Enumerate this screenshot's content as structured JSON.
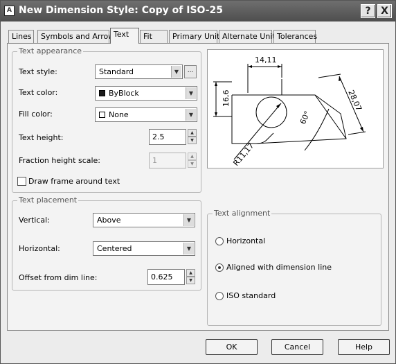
{
  "window": {
    "title": "New Dimension Style: Copy of ISO-25",
    "icon_glyph": "A",
    "help_glyph": "?",
    "close_glyph": "X"
  },
  "tabs": [
    "Lines",
    "Symbols and Arrows",
    "Text",
    "Fit",
    "Primary Units",
    "Alternate Units",
    "Tolerances"
  ],
  "active_tab": "Text",
  "text_appearance": {
    "group_label": "Text appearance",
    "text_style_label": "Text style:",
    "text_style_value": "Standard",
    "text_style_browse": "...",
    "text_color_label": "Text color:",
    "text_color_value": "ByBlock",
    "fill_color_label": "Fill color:",
    "fill_color_value": "None",
    "text_height_label": "Text height:",
    "text_height_value": "2.5",
    "fraction_height_label": "Fraction height scale:",
    "fraction_height_value": "1",
    "draw_frame_label": "Draw frame around text",
    "draw_frame_checked": false
  },
  "text_placement": {
    "group_label": "Text placement",
    "vertical_label": "Vertical:",
    "vertical_value": "Above",
    "horizontal_label": "Horizontal:",
    "horizontal_value": "Centered",
    "offset_label": "Offset from dim line:",
    "offset_value": "0.625"
  },
  "text_alignment": {
    "group_label": "Text alignment",
    "options": [
      "Horizontal",
      "Aligned with dimension line",
      "ISO standard"
    ],
    "selected": "Aligned with dimension line"
  },
  "preview": {
    "dim_top": "14,11",
    "dim_left": "16,6",
    "dim_right": "28,07",
    "dim_angle": "60°",
    "dim_radius": "R11,17"
  },
  "buttons": {
    "ok": "OK",
    "cancel": "Cancel",
    "help": "Help"
  },
  "colors": {
    "titlebar": "#5a5a5a",
    "text_color_swatch": "#1a1a1a",
    "fill_color_swatch": "#ffffff"
  }
}
